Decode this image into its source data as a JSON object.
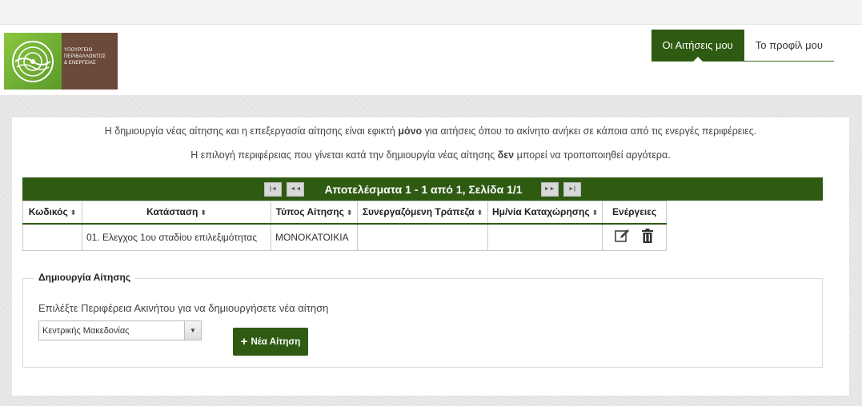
{
  "header": {
    "logo_lines": [
      "ΥΠΟΥΡΓΕΙΟ",
      "ΠΕΡΙΒΑΛΛΟΝΤΟΣ",
      "& ΕΝΕΡΓΕΙΑΣ"
    ],
    "nav": [
      {
        "label": "Οι Αιτήσεις μου",
        "active": true
      },
      {
        "label": "Το προφίλ μου",
        "active": false
      }
    ]
  },
  "info": {
    "line1_pre": "Η δημιουργία νέας αίτησης και η επεξεργασία αίτησης είναι εφικτή ",
    "line1_bold": "μόνο",
    "line1_post": " για αιτήσεις όπου το ακίνητο ανήκει σε κάποια από τις ενεργές περιφέρειες.",
    "line2_pre": "Η επιλογή περιφέρειας που γίνεται κατά την δημιουργία νέας αίτησης ",
    "line2_bold": "δεν",
    "line2_post": " μπορεί να τροποποιηθεί αργότερα."
  },
  "pagination": {
    "results_text": "Αποτελέσματα 1 - 1 από 1, Σελίδα 1/1",
    "first": "|◄",
    "prev": "◄◄",
    "next": "►►",
    "last": "►|"
  },
  "table": {
    "columns": [
      "Κωδικός",
      "Κατάσταση",
      "Τύπος Αίτησης",
      "Συνεργαζόμενη Τράπεζα",
      "Ημ/νία Καταχώρησης",
      "Ενέργειες"
    ],
    "rows": [
      {
        "code": "",
        "status": "01. Ελεγχος 1ου σταδίου επιλεξιμότητας",
        "type": "ΜΟΝΟΚΑΤΟΙΚΙΑ",
        "bank": "",
        "date": ""
      }
    ],
    "sort_glyph": "⬍"
  },
  "create": {
    "legend": "Δημιουργία Αίτησης",
    "prompt": "Επιλέξτε Περιφέρεια Ακινήτου για να δημιουργήσετε νέα αίτηση",
    "region_selected": "Κεντρικής Μακεδονίας",
    "new_button_plus": "+",
    "new_button_label": "Νέα Αίτηση"
  },
  "colors": {
    "primary": "#2e5a12",
    "logo_green": "#8cc63f",
    "logo_brown": "#6b4a3a"
  },
  "icons": [
    "edit-icon",
    "trash-icon",
    "emblem-icon",
    "chevron-down-icon"
  ]
}
